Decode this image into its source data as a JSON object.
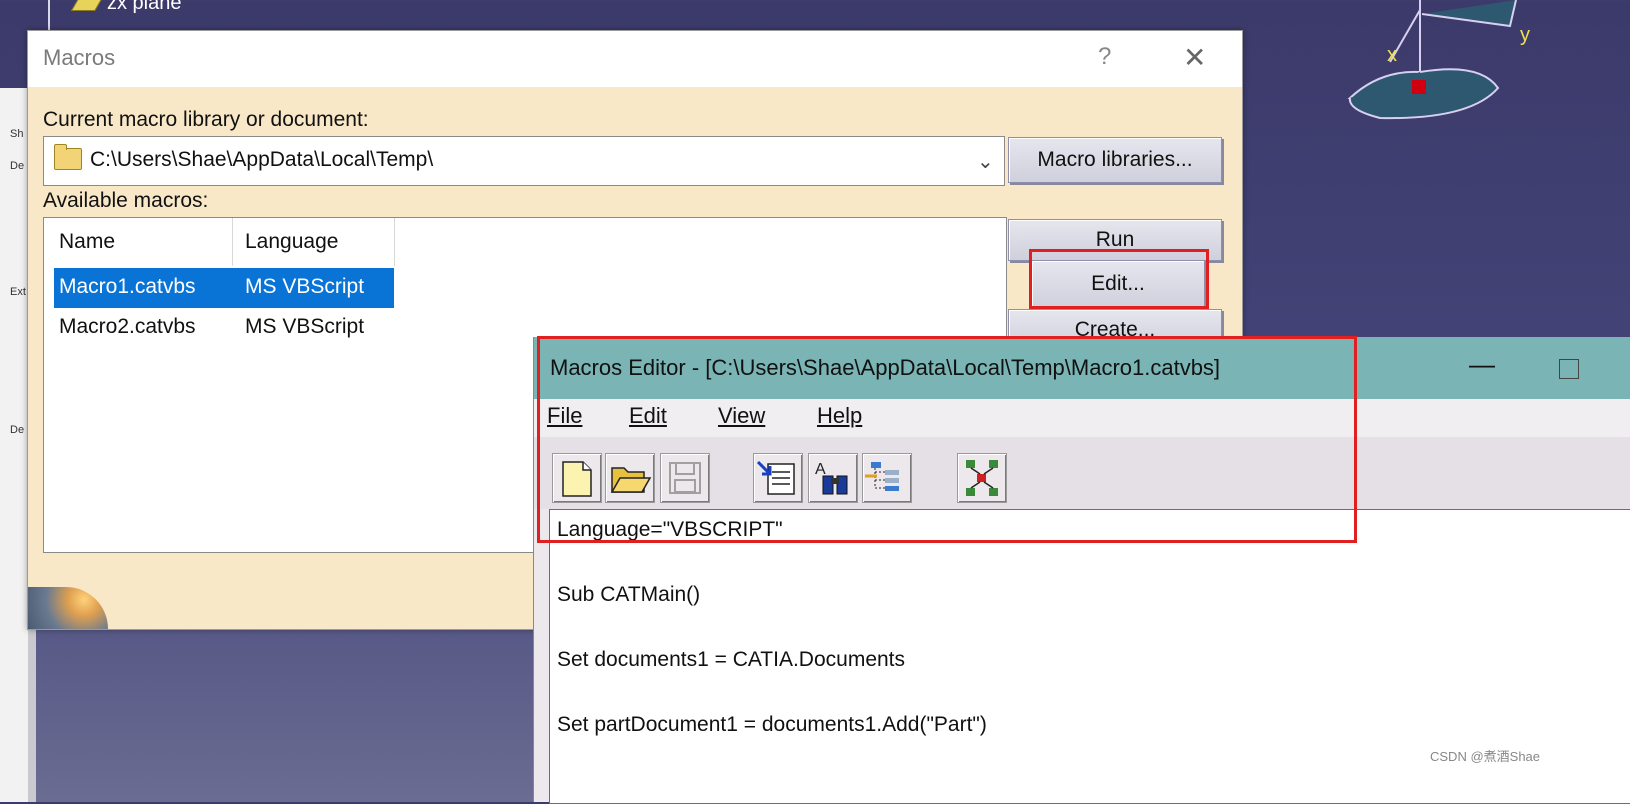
{
  "background": {
    "tree_item": "zx plane",
    "axis_labels": {
      "x": "x",
      "y": "y"
    },
    "left_panel_labels": [
      "Sh",
      "De",
      "Ext",
      "De"
    ]
  },
  "macros_dialog": {
    "title": "Macros",
    "help": "?",
    "close": "✕",
    "current_label": "Current macro library or document:",
    "current_value": "C:\\Users\\Shae\\AppData\\Local\\Temp\\",
    "macro_libraries_button": "Macro libraries...",
    "available_label": "Available macros:",
    "columns": [
      "Name",
      "Language"
    ],
    "rows": [
      {
        "name": "Macro1.catvbs",
        "language": "MS VBScript",
        "selected": true
      },
      {
        "name": "Macro2.catvbs",
        "language": "MS VBScript",
        "selected": false
      }
    ],
    "buttons": {
      "run": "Run",
      "edit": "Edit...",
      "create": "Create..."
    }
  },
  "editor": {
    "title": "Macros Editor - [C:\\Users\\Shae\\AppData\\Local\\Temp\\Macro1.catvbs]",
    "minimize": "—",
    "menu": [
      "File",
      "Edit",
      "View",
      "Help"
    ],
    "code_lines": [
      "Language=\"VBSCRIPT\"",
      "",
      "Sub CATMain()",
      "",
      "Set documents1 = CATIA.Documents",
      "",
      "Set partDocument1 = documents1.Add(\"Part\")"
    ]
  },
  "toolbar_icons": [
    "new-file-icon",
    "open-folder-icon",
    "save-icon",
    "insert-object-icon",
    "find-icon",
    "object-browser-icon",
    "tree-diagram-icon"
  ],
  "watermark": "CSDN @煮酒Shae",
  "colors": {
    "selection": "#0a74d6",
    "editor_title": "#7ab4b4",
    "dialog_bg": "#f8e8c8",
    "highlight": "#e02020"
  }
}
